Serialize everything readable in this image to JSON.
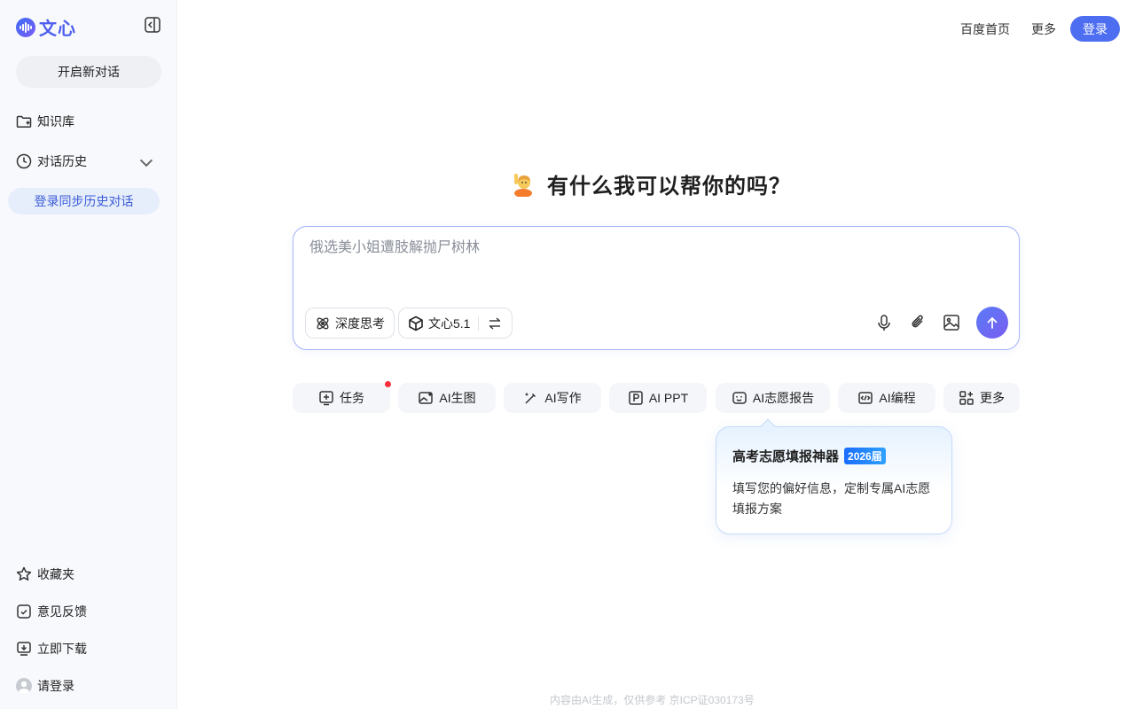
{
  "app": {
    "logo_text": "文心"
  },
  "sidebar": {
    "new_chat": "开启新对话",
    "knowledge": "知识库",
    "history": "对话历史",
    "login_sync": "登录同步历史对话",
    "favorites": "收藏夹",
    "feedback": "意见反馈",
    "download": "立即下载",
    "login": "请登录"
  },
  "header": {
    "baidu_home": "百度首页",
    "more": "更多",
    "login": "登录"
  },
  "main": {
    "greeting": "有什么我可以帮你的吗？",
    "input": {
      "placeholder": "俄选美小姐遭肢解抛尸树林",
      "value": ""
    },
    "chips": {
      "deep_think": "深度思考",
      "model": "文心5.1"
    },
    "features": [
      {
        "label": "任务"
      },
      {
        "label": "AI生图"
      },
      {
        "label": "AI写作"
      },
      {
        "label": "AI PPT"
      },
      {
        "label": "AI志愿报告"
      },
      {
        "label": "AI编程"
      },
      {
        "label": "更多"
      }
    ]
  },
  "popover": {
    "title": "高考志愿填报神器",
    "badge": "2026届",
    "desc": "填写您的偏好信息，定制专属AI志愿填报方案"
  },
  "footer": {
    "text": "内容由AI生成，仅供参考  京ICP证030173号"
  },
  "colors": {
    "accent": "#4e6ef2",
    "sidebar_bg": "#f8f9fc",
    "chip_bg": "#f4f6fa"
  }
}
